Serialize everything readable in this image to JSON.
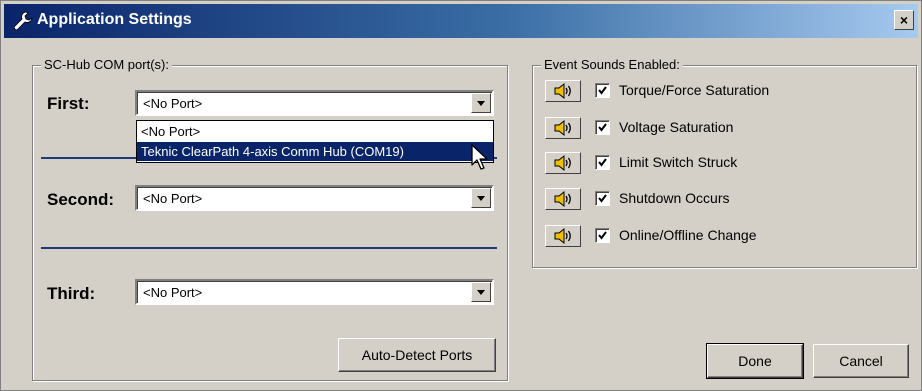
{
  "window": {
    "title": "Application Settings",
    "close_glyph": "×"
  },
  "com_ports": {
    "legend": "SC-Hub COM port(s):",
    "first": {
      "label": "First:",
      "value": "<No Port>"
    },
    "second": {
      "label": "Second:",
      "value": "<No Port>"
    },
    "third": {
      "label": "Third:",
      "value": "<No Port>"
    },
    "dropdown_options": [
      "<No Port>",
      "Teknic ClearPath 4-axis Comm Hub (COM19)"
    ],
    "highlighted_option_index": 1,
    "auto_detect_label": "Auto-Detect Ports"
  },
  "sounds": {
    "legend": "Event Sounds Enabled:",
    "items": [
      {
        "label": "Torque/Force Saturation",
        "checked": true,
        "icon": "speaker-icon"
      },
      {
        "label": "Voltage Saturation",
        "checked": true,
        "icon": "speaker-icon"
      },
      {
        "label": "Limit Switch Struck",
        "checked": true,
        "icon": "speaker-icon"
      },
      {
        "label": "Shutdown Occurs",
        "checked": true,
        "icon": "speaker-icon"
      },
      {
        "label": "Online/Offline Change",
        "checked": true,
        "icon": "speaker-icon"
      }
    ]
  },
  "buttons": {
    "done": "Done",
    "cancel": "Cancel"
  },
  "colors": {
    "title_start": "#0a246a",
    "title_end": "#a6caf0",
    "highlight": "#0a246a",
    "face": "#d4d0c8",
    "speaker": "#f0c000"
  }
}
